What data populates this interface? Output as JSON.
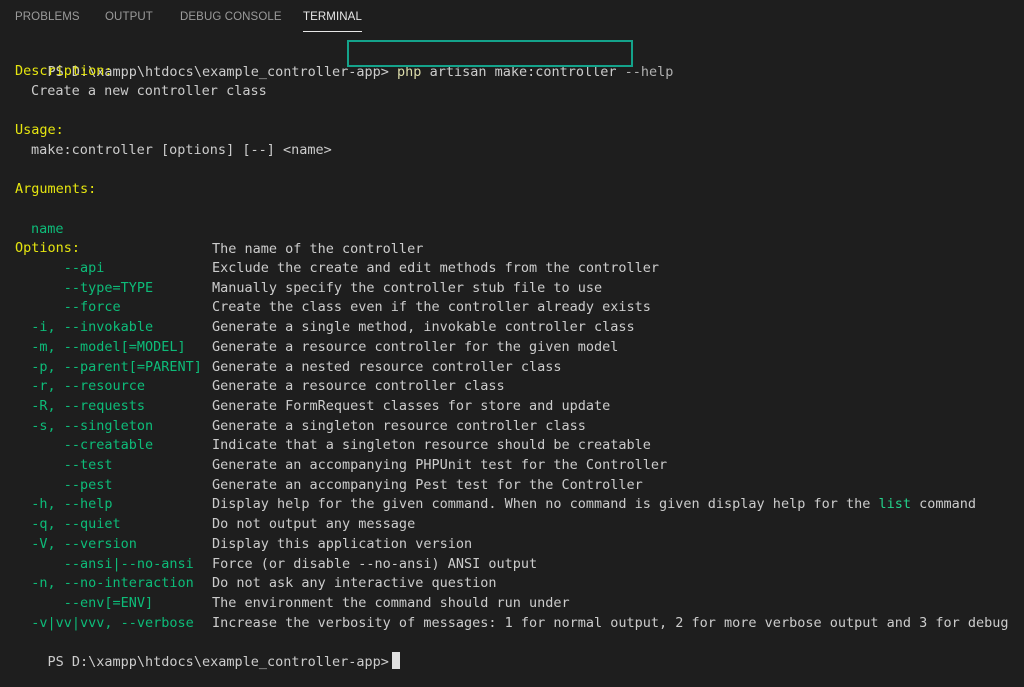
{
  "tabs": [
    {
      "label": "PROBLEMS",
      "active": false
    },
    {
      "label": "OUTPUT",
      "active": false
    },
    {
      "label": "DEBUG CONSOLE",
      "active": false
    },
    {
      "label": "TERMINAL",
      "active": true
    }
  ],
  "terminal": {
    "prompt": "PS D:\\xampp\\htdocs\\example_controller-app>",
    "command": {
      "php": "php",
      "args": "artisan make:controller",
      "flag": "--help"
    },
    "description_header": "Description:",
    "description_text": "Create a new controller class",
    "usage_header": "Usage:",
    "usage_text": "make:controller [options] [--] <name>",
    "arguments_header": "Arguments:",
    "arguments": [
      {
        "name": "name",
        "desc": "The name of the controller"
      }
    ],
    "options_header": "Options:",
    "options": [
      {
        "name": "      --api",
        "desc": "Exclude the create and edit methods from the controller"
      },
      {
        "name": "      --type=TYPE",
        "desc": "Manually specify the controller stub file to use"
      },
      {
        "name": "      --force",
        "desc": "Create the class even if the controller already exists"
      },
      {
        "name": "  -i, --invokable",
        "desc": "Generate a single method, invokable controller class"
      },
      {
        "name": "  -m, --model[=MODEL]",
        "desc": "Generate a resource controller for the given model"
      },
      {
        "name": "  -p, --parent[=PARENT]",
        "desc": "Generate a nested resource controller class"
      },
      {
        "name": "  -r, --resource",
        "desc": "Generate a resource controller class"
      },
      {
        "name": "  -R, --requests",
        "desc": "Generate FormRequest classes for store and update"
      },
      {
        "name": "  -s, --singleton",
        "desc": "Generate a singleton resource controller class"
      },
      {
        "name": "      --creatable",
        "desc": "Indicate that a singleton resource should be creatable"
      },
      {
        "name": "      --test",
        "desc": "Generate an accompanying PHPUnit test for the Controller"
      },
      {
        "name": "      --pest",
        "desc": "Generate an accompanying Pest test for the Controller"
      },
      {
        "name": "  -h, --help",
        "desc": "Display help for the given command. When no command is given display help for the ",
        "desc_highlight": "list",
        "desc_after": " command"
      },
      {
        "name": "  -q, --quiet",
        "desc": "Do not output any message"
      },
      {
        "name": "  -V, --version",
        "desc": "Display this application version"
      },
      {
        "name": "      --ansi|--no-ansi",
        "desc": "Force (or disable --no-ansi) ANSI output"
      },
      {
        "name": "  -n, --no-interaction",
        "desc": "Do not ask any interactive question"
      },
      {
        "name": "      --env[=ENV]",
        "desc": "The environment the command should run under"
      },
      {
        "name": "  -v|vv|vvv, --verbose",
        "desc": "Increase the verbosity of messages: 1 for normal output, 2 for more verbose output and 3 for debug"
      }
    ],
    "final_prompt": "PS D:\\xampp\\htdocs\\example_controller-app>"
  },
  "colors": {
    "background": "#1e1e1e",
    "header_yellow": "#e5e510",
    "option_green": "#0dbc79",
    "highlight_box": "#14a38b"
  }
}
